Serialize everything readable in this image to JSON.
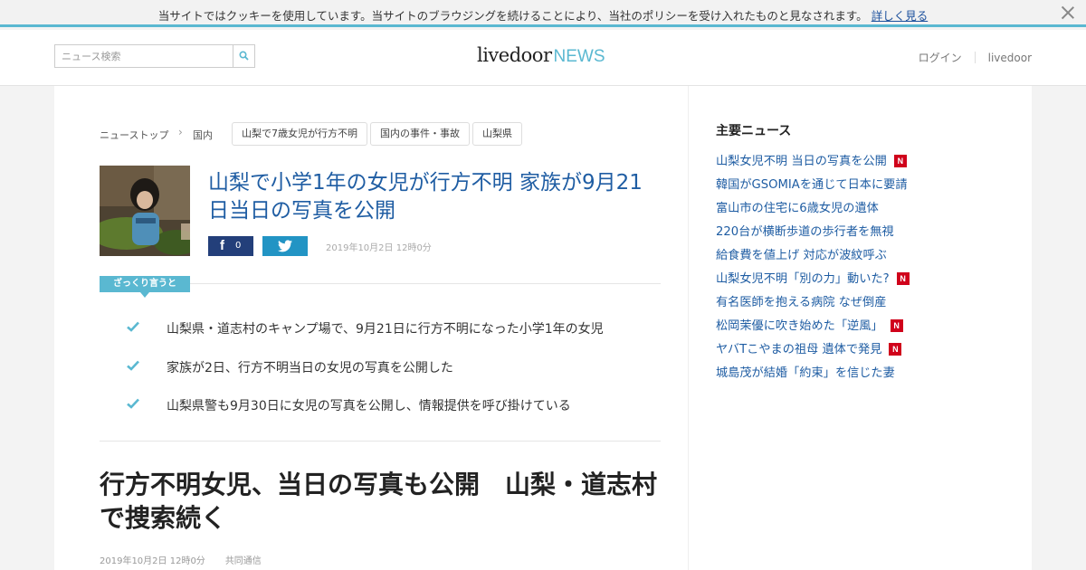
{
  "cookie_bar": {
    "text": "当サイトではクッキーを使用しています。当サイトのブラウジングを続けることにより、当社のポリシーを受け入れたものと見なされます。",
    "link_label": "詳しく見る"
  },
  "header": {
    "search_placeholder": "ニュース検索",
    "logo_main": "livedoor",
    "logo_sub": "NEWS",
    "links": [
      "ログイン",
      "livedoor"
    ]
  },
  "breadcrumb": {
    "items": [
      "ニューストップ",
      "国内"
    ],
    "tags": [
      "山梨で7歳女児が行方不明",
      "国内の事件・事故",
      "山梨県"
    ]
  },
  "article_header": {
    "headline": "山梨で小学1年の女児が行方不明 家族が9月21日当日の写真を公開",
    "fb_count": "0",
    "date": "2019年10月2日 12時0分"
  },
  "summary": {
    "label": "ざっくり言うと",
    "items": [
      "山梨県・道志村のキャンプ場で、9月21日に行方不明になった小学1年の女児",
      "家族が2日、行方不明当日の女児の写真を公開した",
      "山梨県警も9月30日に女児の写真を公開し、情報提供を呼び掛けている"
    ]
  },
  "article": {
    "title": "行方不明女児、当日の写真も公開　山梨・道志村で捜索続く",
    "date": "2019年10月2日 12時0分",
    "source": "共同通信"
  },
  "sidebar": {
    "title": "主要ニュース",
    "items": [
      {
        "text": "山梨女児不明 当日の写真を公開",
        "new": true,
        "badge": "N"
      },
      {
        "text": "韓国がGSOMIAを通じて日本に要請",
        "new": false
      },
      {
        "text": "富山市の住宅に6歳女児の遺体",
        "new": false
      },
      {
        "text": "220台が横断歩道の歩行者を無視",
        "new": false
      },
      {
        "text": "給食費を値上げ 対応が波紋呼ぶ",
        "new": false
      },
      {
        "text": "山梨女児不明「別の力」動いた?",
        "new": true,
        "badge": "N"
      },
      {
        "text": "有名医師を抱える病院 なぜ倒産",
        "new": false
      },
      {
        "text": "松岡茉優に吹き始めた「逆風」",
        "new": true,
        "badge": "N"
      },
      {
        "text": "ヤバTこやまの祖母 遺体で発見",
        "new": true,
        "badge": "N"
      },
      {
        "text": "城島茂が結婚「約束」を信じた妻",
        "new": false
      }
    ]
  },
  "colors": {
    "accent": "#5ab8d1",
    "link": "#1f5da3",
    "facebook": "#233f7a",
    "twitter": "#2294c4",
    "new_badge": "#d0021b"
  }
}
